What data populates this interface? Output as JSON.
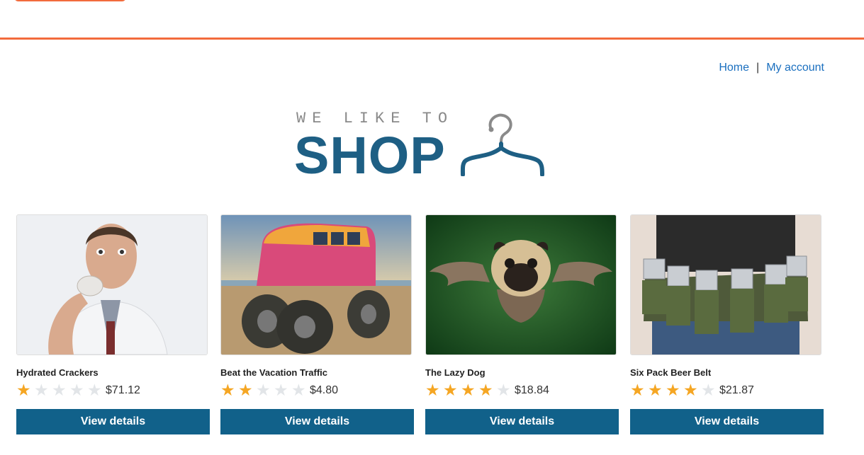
{
  "colors": {
    "accent": "#f26b3c",
    "brand": "#1e5f84",
    "button": "#11618a",
    "link": "#1a6fbf",
    "star": "#f5a623"
  },
  "nav": {
    "home": "Home",
    "separator": "|",
    "account": "My account"
  },
  "banner": {
    "tagline": "WE LIKE TO",
    "title": "SHOP",
    "icon": "hanger-icon"
  },
  "products": [
    {
      "name": "Hydrated Crackers",
      "rating": 1,
      "price": "$71.12",
      "button": "View details"
    },
    {
      "name": "Beat the Vacation Traffic",
      "rating": 2,
      "price": "$4.80",
      "button": "View details"
    },
    {
      "name": "The Lazy Dog",
      "rating": 4,
      "price": "$18.84",
      "button": "View details"
    },
    {
      "name": "Six Pack Beer Belt",
      "rating": 4,
      "price": "$21.87",
      "button": "View details"
    }
  ]
}
